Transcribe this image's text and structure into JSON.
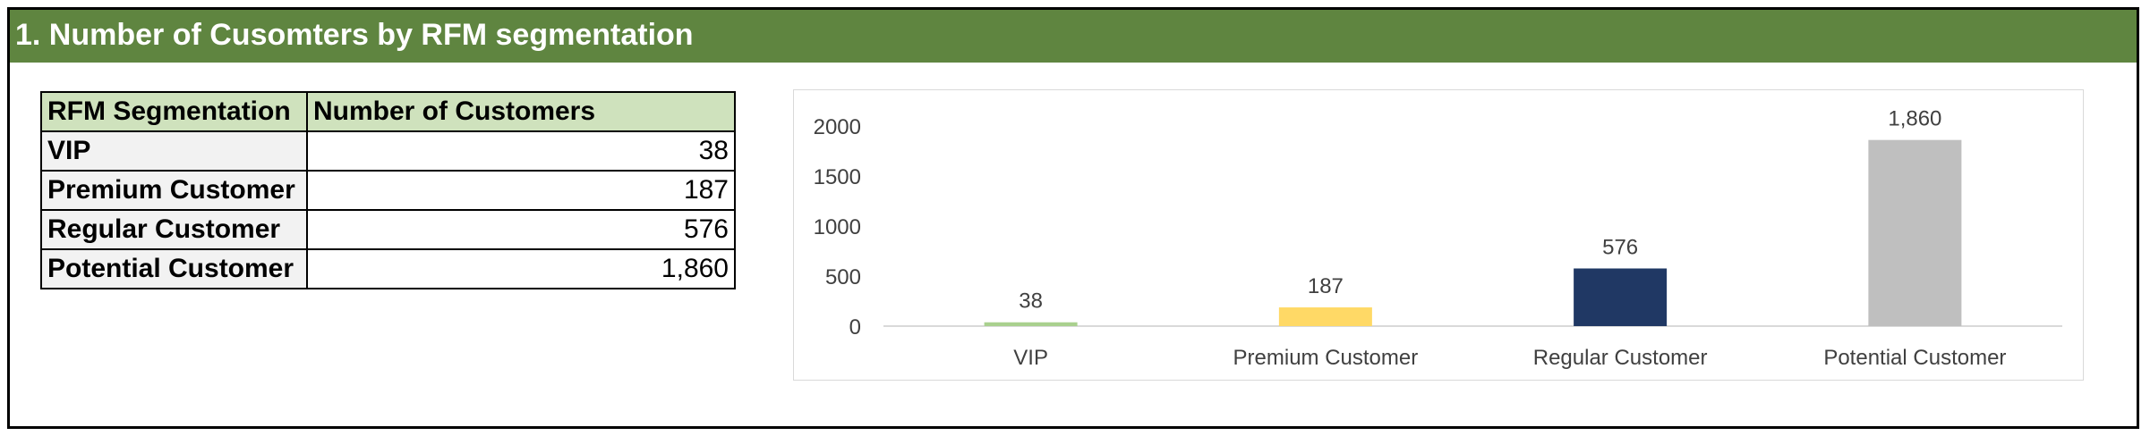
{
  "header": {
    "title": "1. Number of Cusomters by RFM segmentation"
  },
  "table": {
    "columns": [
      "RFM Segmentation",
      "Number of Customers"
    ],
    "rows": [
      {
        "segment": "VIP",
        "count": "38"
      },
      {
        "segment": "Premium Customer",
        "count": "187"
      },
      {
        "segment": "Regular Customer",
        "count": "576"
      },
      {
        "segment": "Potential Customer",
        "count": "1,860"
      }
    ]
  },
  "chart_data": {
    "type": "bar",
    "categories": [
      "VIP",
      "Premium Customer",
      "Regular Customer",
      "Potential Customer"
    ],
    "values": [
      38,
      187,
      576,
      1860
    ],
    "data_labels": [
      "38",
      "187",
      "576",
      "1,860"
    ],
    "bar_colors": [
      "#a9d08e",
      "#ffd966",
      "#203864",
      "#bfbfbf"
    ],
    "yticks": [
      0,
      500,
      1000,
      1500,
      2000
    ],
    "ylim": [
      0,
      2000
    ],
    "title": "",
    "xlabel": "",
    "ylabel": "",
    "grid": false,
    "legend": "none"
  }
}
